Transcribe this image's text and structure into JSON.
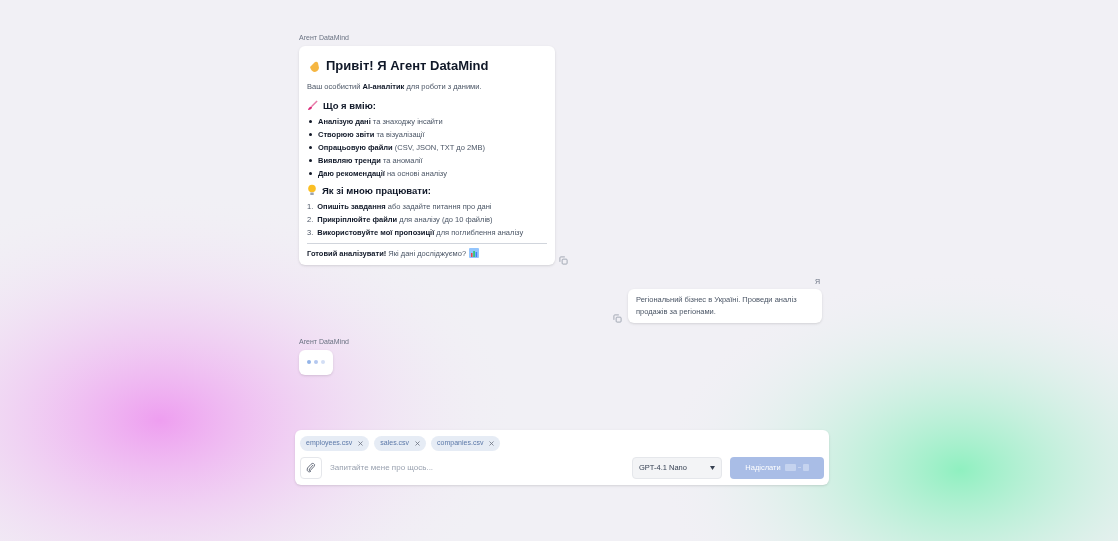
{
  "messages": [
    {
      "kind": "agent",
      "author": "Агент DataMind",
      "title": "Привіт! Я Агент DataMind",
      "intro": "Ваш особистий **AI-аналітик** для роботи з даними.",
      "sections": [
        {
          "kind": "bullets",
          "heading": "Що я вмію:",
          "items": [
            {
              "text": "**Аналізую дані** та знаходжу інсайти"
            },
            {
              "text": "**Створюю звіти** та візуалізації"
            },
            {
              "text": "**Опрацьовую файли** (CSV, JSON, TXT до 2MB)"
            },
            {
              "text": "**Виявляю тренди** та аномалії"
            },
            {
              "text": "**Даю рекомендації** на основі аналізу"
            }
          ]
        },
        {
          "kind": "numbered",
          "heading": "Як зі мною працювати:",
          "items": [
            {
              "marker": "1.",
              "text": "**Опишіть завдання** або задайте питання про дані"
            },
            {
              "marker": "2.",
              "text": "**Прикріплюйте файли** для аналізу (до 10 файлів)"
            },
            {
              "marker": "3.",
              "text": "**Використовуйте мої пропозиції** для поглиблення аналізу"
            }
          ]
        }
      ],
      "footer": "**Готовий аналізувати!** Які дані досліджуємо?"
    },
    {
      "kind": "user",
      "author": "Я",
      "text": "Регіональний бізнес в Україні. Проведи аналіз продажів за регіонами."
    },
    {
      "kind": "typing",
      "author": "Агент DataMind"
    }
  ],
  "composer": {
    "attachments": [
      "employees.csv",
      "sales.csv",
      "companies.csv"
    ],
    "placeholder": "Запитайте мене про щось...",
    "model": "GPT-4.1 Nano",
    "send_label": "Надіслати",
    "send_disabled": true
  }
}
